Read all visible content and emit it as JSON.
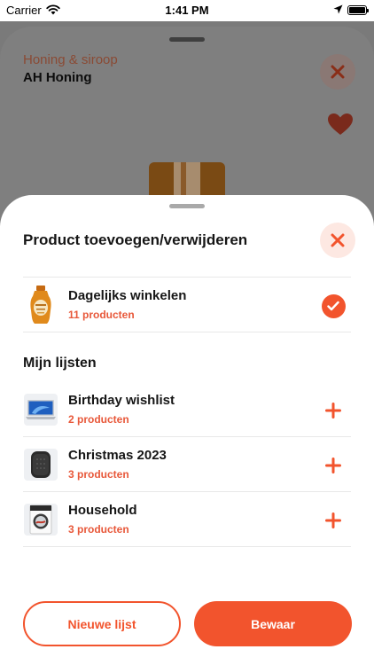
{
  "status_bar": {
    "carrier": "Carrier",
    "time": "1:41 PM"
  },
  "background_product": {
    "category": "Honing & siroop",
    "title": "AH Honing"
  },
  "sheet": {
    "title": "Product toevoegen/verwijderen",
    "current_list": {
      "name": "Dagelijks winkelen",
      "count": "11 producten",
      "selected": true,
      "icon": "honey-bottle-image"
    },
    "my_lists_heading": "Mijn lijsten",
    "lists": [
      {
        "name": "Birthday wishlist",
        "count": "2 producten",
        "icon": "laptop-image"
      },
      {
        "name": "Christmas 2023",
        "count": "3 producten",
        "icon": "speaker-image"
      },
      {
        "name": "Household",
        "count": "3 producten",
        "icon": "washing-machine-image"
      }
    ],
    "new_list_label": "Nieuwe lijst",
    "save_label": "Bewaar"
  },
  "colors": {
    "accent": "#f2542d",
    "accent_light": "#fde8e2",
    "count_text": "#e8583a"
  }
}
